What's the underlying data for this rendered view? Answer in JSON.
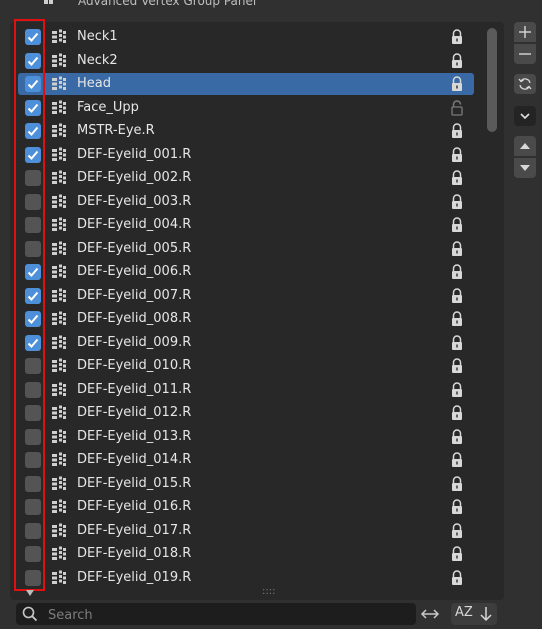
{
  "panel": {
    "title": "Advanced Vertex Group Panel"
  },
  "vertex_groups": [
    {
      "name": "Neck1",
      "checked": true,
      "selected": false,
      "locked": true
    },
    {
      "name": "Neck2",
      "checked": true,
      "selected": false,
      "locked": true
    },
    {
      "name": "Head",
      "checked": true,
      "selected": true,
      "locked": true
    },
    {
      "name": "Face_Upp",
      "checked": true,
      "selected": false,
      "locked": false
    },
    {
      "name": "MSTR-Eye.R",
      "checked": true,
      "selected": false,
      "locked": true
    },
    {
      "name": "DEF-Eyelid_001.R",
      "checked": true,
      "selected": false,
      "locked": true
    },
    {
      "name": "DEF-Eyelid_002.R",
      "checked": false,
      "selected": false,
      "locked": true
    },
    {
      "name": "DEF-Eyelid_003.R",
      "checked": false,
      "selected": false,
      "locked": true
    },
    {
      "name": "DEF-Eyelid_004.R",
      "checked": false,
      "selected": false,
      "locked": true
    },
    {
      "name": "DEF-Eyelid_005.R",
      "checked": false,
      "selected": false,
      "locked": true
    },
    {
      "name": "DEF-Eyelid_006.R",
      "checked": true,
      "selected": false,
      "locked": true
    },
    {
      "name": "DEF-Eyelid_007.R",
      "checked": true,
      "selected": false,
      "locked": true
    },
    {
      "name": "DEF-Eyelid_008.R",
      "checked": true,
      "selected": false,
      "locked": true
    },
    {
      "name": "DEF-Eyelid_009.R",
      "checked": true,
      "selected": false,
      "locked": true
    },
    {
      "name": "DEF-Eyelid_010.R",
      "checked": false,
      "selected": false,
      "locked": true
    },
    {
      "name": "DEF-Eyelid_011.R",
      "checked": false,
      "selected": false,
      "locked": true
    },
    {
      "name": "DEF-Eyelid_012.R",
      "checked": false,
      "selected": false,
      "locked": true
    },
    {
      "name": "DEF-Eyelid_013.R",
      "checked": false,
      "selected": false,
      "locked": true
    },
    {
      "name": "DEF-Eyelid_014.R",
      "checked": false,
      "selected": false,
      "locked": true
    },
    {
      "name": "DEF-Eyelid_015.R",
      "checked": false,
      "selected": false,
      "locked": true
    },
    {
      "name": "DEF-Eyelid_016.R",
      "checked": false,
      "selected": false,
      "locked": true
    },
    {
      "name": "DEF-Eyelid_017.R",
      "checked": false,
      "selected": false,
      "locked": true
    },
    {
      "name": "DEF-Eyelid_018.R",
      "checked": false,
      "selected": false,
      "locked": true
    },
    {
      "name": "DEF-Eyelid_019.R",
      "checked": false,
      "selected": false,
      "locked": true
    }
  ],
  "search": {
    "placeholder": "Search",
    "value": ""
  },
  "sort": {
    "label": "AZ"
  },
  "side_buttons": [
    "add-icon",
    "remove-icon",
    "refresh-icon",
    "chevron-down-icon",
    "move-up-icon",
    "move-down-icon"
  ],
  "colors": {
    "selection": "#3a6aa5",
    "checkbox_on": "#4d8fd8",
    "highlight_box": "#e01010"
  }
}
